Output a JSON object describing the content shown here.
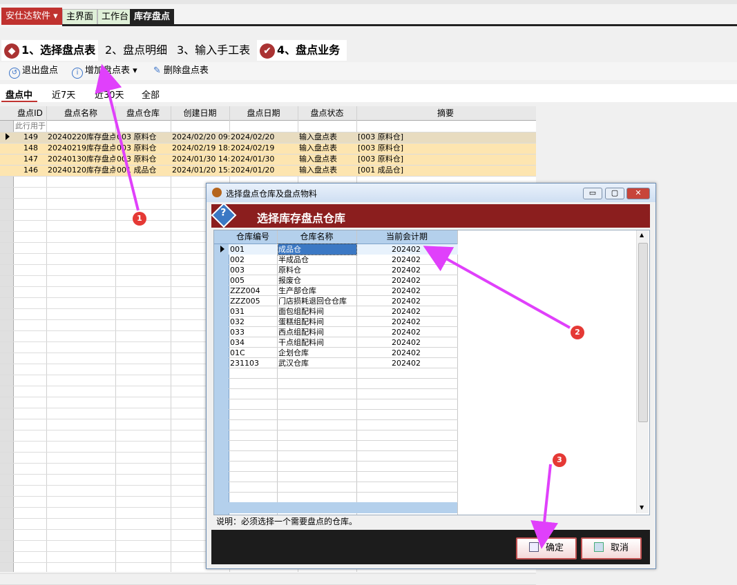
{
  "app": {
    "brand": "安仕达软件"
  },
  "top_tabs": [
    "主界面",
    "工作台",
    "库存盘点"
  ],
  "steps": [
    "1、选择盘点表",
    "2、盘点明细",
    "3、输入手工表",
    "4、盘点业务"
  ],
  "toolbar": {
    "exit": "退出盘点",
    "add": "增加盘点表",
    "delete": "删除盘点表"
  },
  "filters": [
    "盘点中",
    "近7天",
    "近30天",
    "全部"
  ],
  "main_grid": {
    "columns": [
      "盘点ID",
      "盘点名称",
      "盘点仓库",
      "创建日期",
      "盘点日期",
      "盘点状态",
      "摘要"
    ],
    "filter_row": "此行用于",
    "rows": [
      [
        "149",
        "20240220库存盘点",
        "003 原料仓",
        "2024/02/20 09:2",
        "2024/02/20",
        "输入盘点表",
        "[003 原料仓]"
      ],
      [
        "148",
        "20240219库存盘点",
        "003 原料仓",
        "2024/02/19 18:1",
        "2024/02/19",
        "输入盘点表",
        "[003 原料仓]"
      ],
      [
        "147",
        "20240130库存盘点",
        "003 原料仓",
        "2024/01/30 14:3",
        "2024/01/30",
        "输入盘点表",
        "[003 原料仓]"
      ],
      [
        "146",
        "20240120库存盘点",
        "001 成品仓",
        "2024/01/20 15:5",
        "2024/01/20",
        "输入盘点表",
        "[001 成品仓]"
      ]
    ]
  },
  "dialog": {
    "title": "选择盘点仓库及盘点物料",
    "header": "选择库存盘点仓库",
    "columns": [
      "仓库编号",
      "仓库名称",
      "当前会计期"
    ],
    "rows": [
      [
        "001",
        "成品仓",
        "202402"
      ],
      [
        "002",
        "半成品仓",
        "202402"
      ],
      [
        "003",
        "原料仓",
        "202402"
      ],
      [
        "005",
        "报废仓",
        "202402"
      ],
      [
        "ZZZ004",
        "生产部仓库",
        "202402"
      ],
      [
        "ZZZ005",
        "门店损耗退回仓仓库",
        "202402"
      ],
      [
        "031",
        "面包组配料间",
        "202402"
      ],
      [
        "032",
        "蛋糕组配料间",
        "202402"
      ],
      [
        "033",
        "西点组配料间",
        "202402"
      ],
      [
        "034",
        "干点组配料间",
        "202402"
      ],
      [
        "01C",
        "企划仓库",
        "202402"
      ],
      [
        "231103",
        "武汉仓库",
        "202402"
      ]
    ],
    "note": "说明：必须选择一个需要盘点的仓库。",
    "ok": "确定",
    "cancel": "取消"
  },
  "annotations": [
    "1",
    "2",
    "3"
  ],
  "colors": {
    "brand": "#c0322f",
    "row_highlight": "#fde5b0",
    "dialog_header": "#8b1e1e",
    "arrow": "#e040fb"
  }
}
